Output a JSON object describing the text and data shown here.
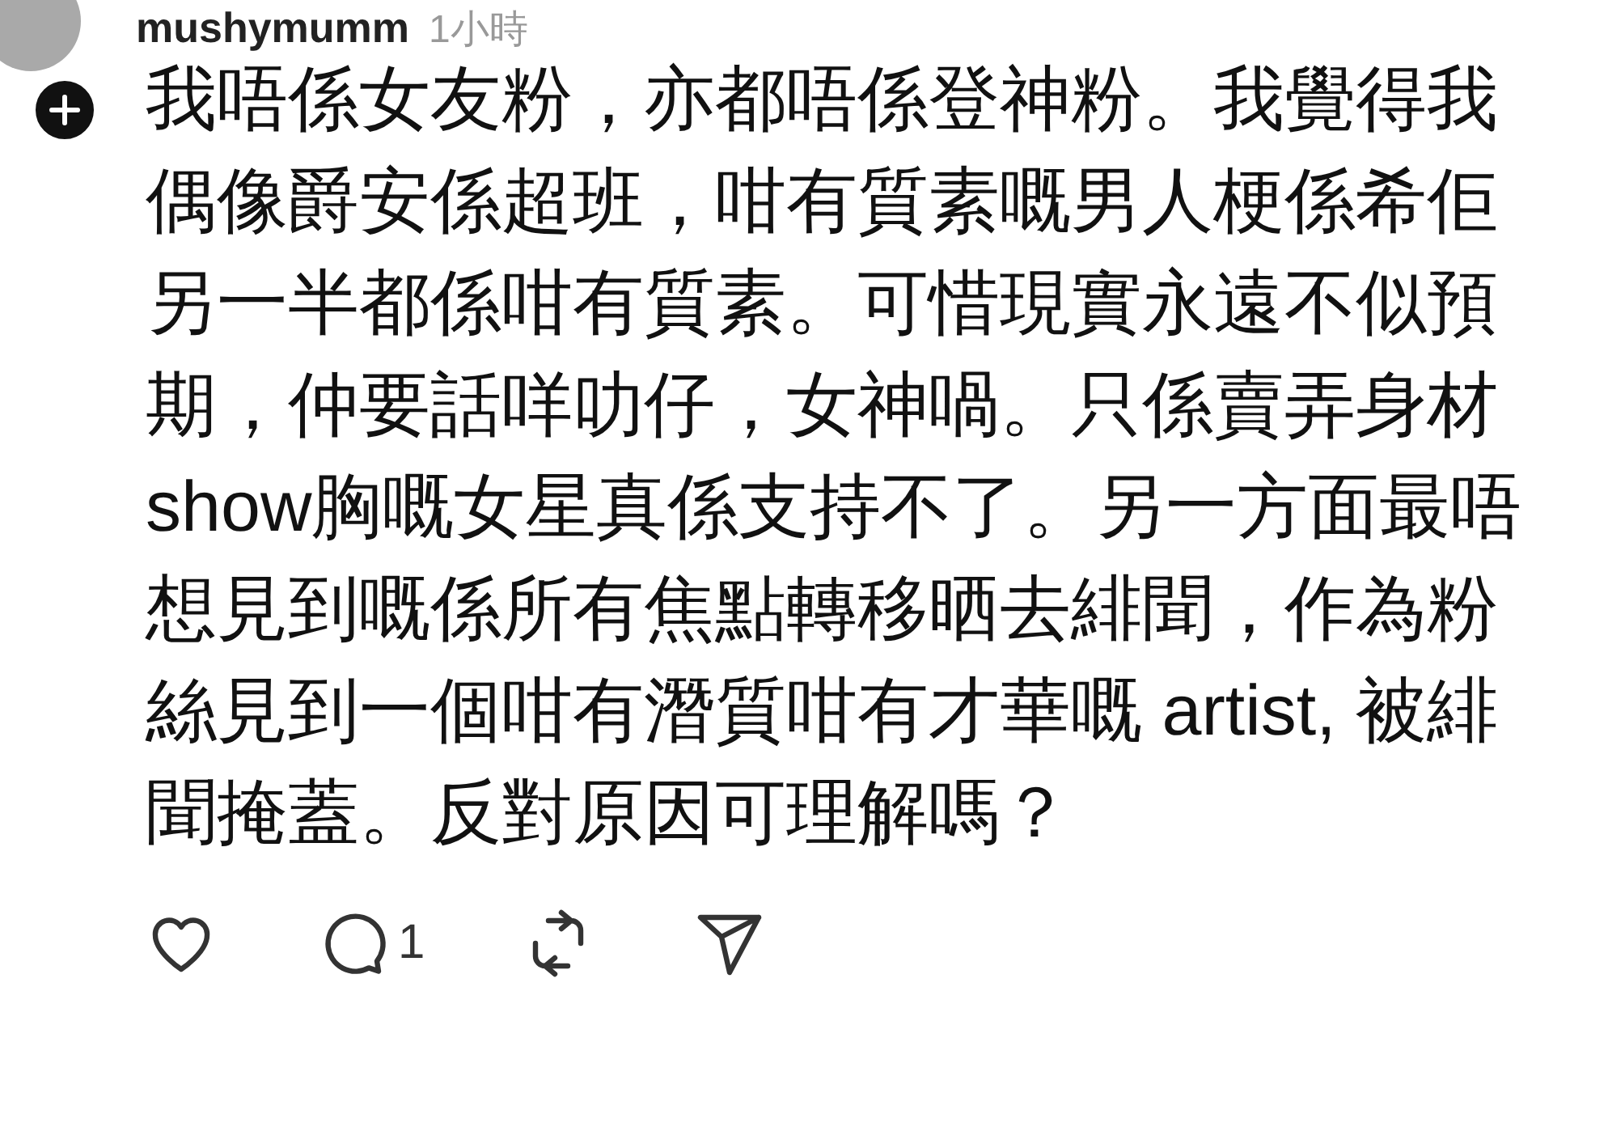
{
  "post": {
    "username": "mushymumm",
    "time": "1小時",
    "text": "我唔係女友粉，亦都唔係登神粉。我覺得我偶像爵安係超班，咁有質素嘅男人梗係希佢另一半都係咁有質素。可惜現實永遠不似預期，仲要話咩叻仔，女神喎。只係賣弄身材show胸嘅女星真係支持不了。另一方面最唔想見到嘅係所有焦點轉移晒去緋聞，作為粉絲見到一個咁有潛質咁有才華嘅 artist, 被緋聞掩蓋。反對原因可理解嗎？",
    "actions": [
      {
        "kind": "like"
      },
      {
        "kind": "reply",
        "count": "1"
      },
      {
        "kind": "repost"
      },
      {
        "kind": "share"
      }
    ]
  }
}
